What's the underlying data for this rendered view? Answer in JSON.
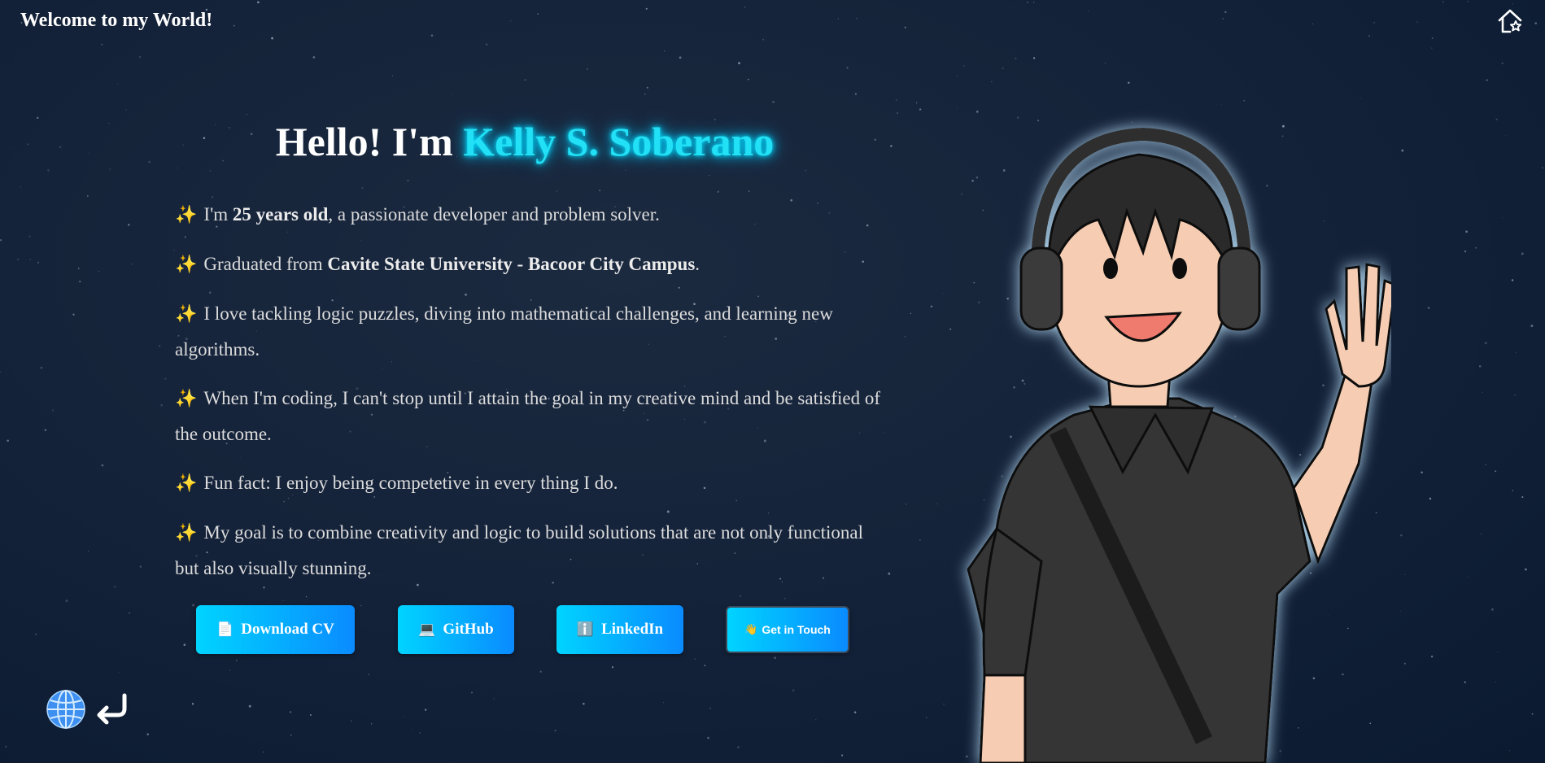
{
  "header": {
    "title": "Welcome to my World!",
    "home_icon": "home-star-icon"
  },
  "hero": {
    "greeting": "Hello! I'm",
    "name": "Kelly S. Soberano",
    "name_color": "#22e0f5"
  },
  "bio": {
    "bullet_icon": "sparkles-icon",
    "bullet": "✨",
    "items": [
      {
        "pre": "I'm ",
        "bold": "25 years old",
        "post": ", a passionate developer and problem solver."
      },
      {
        "pre": "Graduated from ",
        "bold": "Cavite State University - Bacoor City Campus",
        "post": "."
      },
      {
        "pre": "I love tackling logic puzzles, diving into mathematical challenges, and learning new algorithms.",
        "bold": "",
        "post": ""
      },
      {
        "pre": "When I'm coding, I can't stop until I attain the goal in my creative mind and be satisfied of the outcome.",
        "bold": "",
        "post": ""
      },
      {
        "pre": "Fun fact: I enjoy being competetive in every thing I do.",
        "bold": "",
        "post": ""
      },
      {
        "pre": "My goal is to combine creativity and logic to build solutions that are not only functional but also visually stunning.",
        "bold": "",
        "post": ""
      }
    ]
  },
  "buttons": {
    "download_cv": {
      "icon": "📄",
      "icon_name": "document-icon",
      "label": "Download CV"
    },
    "github": {
      "icon": "💻",
      "icon_name": "laptop-icon",
      "label": "GitHub"
    },
    "linkedin": {
      "icon": "ℹ️",
      "icon_name": "info-icon",
      "label": "LinkedIn"
    },
    "get_in_touch": {
      "icon": "👋",
      "icon_name": "waving-hand-icon",
      "label": "Get in Touch"
    }
  },
  "footer": {
    "globe_icon": "globe-icon",
    "back_icon": "return-arrow-icon"
  },
  "colors": {
    "background": "#14223a",
    "accent": "#00d4ff",
    "button_gradient_end": "#0a8bff"
  }
}
